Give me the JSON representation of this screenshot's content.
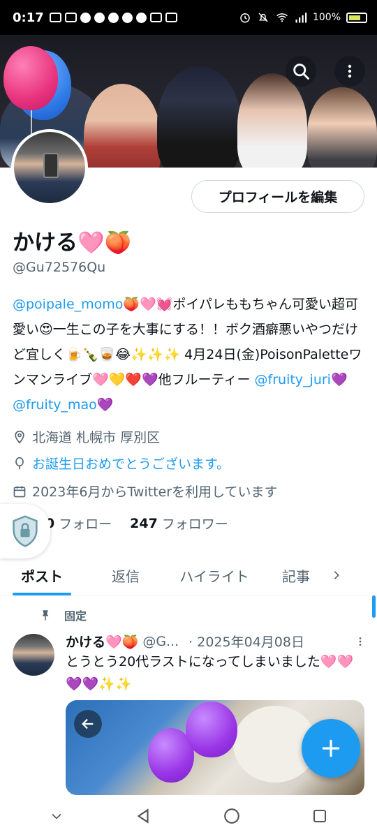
{
  "status_bar": {
    "time": "0:17",
    "battery": "100%"
  },
  "profile": {
    "name": "かける🩷🍑",
    "handle": "@Gu72576Qu",
    "edit_label": "プロフィールを編集",
    "bio_parts": [
      {
        "text": "@poipale_momo",
        "mention": true
      },
      {
        "text": "🍑🩷💓ポイパレももちゃん可愛い超可愛い😍一生この子を大事にする！！ボク酒癖悪いやつだけど宜しく🍺🍾🥃😂✨✨✨ 4月24日(金)PoisonPaletteワンマンライブ🩷💛❤️💜他フルーティー ",
        "mention": false
      },
      {
        "text": "@fruity_juri",
        "mention": true
      },
      {
        "text": "💜 ",
        "mention": false
      },
      {
        "text": "@fruity_mao",
        "mention": true
      },
      {
        "text": "💜",
        "mention": false
      }
    ],
    "location": "北海道 札幌市 厚別区",
    "birthday": "お誕生日おめでとうございます。",
    "joined": "2023年6月からTwitterを利用しています",
    "following_count": "1,210",
    "following_label": "フォロー",
    "followers_count": "247",
    "followers_label": "フォロワー"
  },
  "tabs": [
    "ポスト",
    "返信",
    "ハイライト",
    "記事"
  ],
  "pinned_label": "固定",
  "tweet": {
    "name": "かける🩷🍑",
    "handle": "@G...",
    "date": "· 2025年04月08日",
    "text": "とうとう20代ラストになってしまいました🩷🩷💜💜✨✨"
  },
  "colors": {
    "accent": "#1d9bf0",
    "text": "#0f1419",
    "muted": "#536471"
  },
  "icons": [
    "search-icon",
    "more-vertical-icon",
    "location-icon",
    "balloon-icon",
    "calendar-icon",
    "pin-icon",
    "plus-icon",
    "back-icon",
    "shield-lock-icon"
  ]
}
